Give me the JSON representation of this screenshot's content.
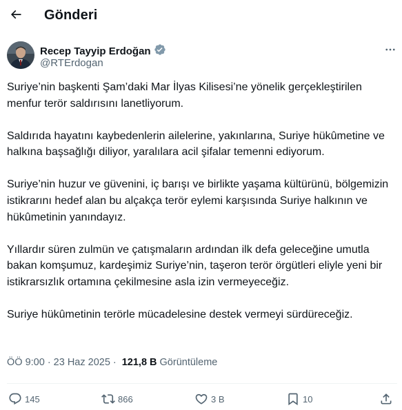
{
  "header": {
    "title": "Gönderi",
    "back_icon": "arrow-left-icon"
  },
  "author": {
    "name": "Recep Tayyip Erdoğan",
    "handle": "@RTErdogan",
    "verified_icon": "verified-badge-icon",
    "verified_color": "#829aab"
  },
  "tweet": {
    "paragraphs": [
      "Suriye’nin başkenti Şam’daki Mar İlyas Kilisesi’ne yönelik gerçekleştirilen menfur terör saldırısını lanetliyorum.",
      "Saldırıda hayatını kaybedenlerin ailelerine, yakınlarına, Suriye hükûmetine ve halkına başsağlığı diliyor, yaralılara acil şifalar temenni ediyorum.",
      "Suriye’nin huzur ve güvenini, iç barışı ve birlikte yaşama kültürünü, bölgemizin istikrarını hedef alan bu alçakça terör eylemi karşısında Suriye halkının ve hükûmetinin yanındayız.",
      "Yıllardır süren zulmün ve çatışmaların ardından ilk defa geleceğine umutla bakan komşumuz, kardeşimiz Suriye’nin, taşeron terör örgütleri eliyle yeni bir istikrarsızlık ortamına çekilmesine asla izin vermeyeceğiz.",
      "Suriye hükûmetinin terörle mücadelesine destek vermeyi sürdüreceğiz."
    ]
  },
  "meta": {
    "time": "ÖÖ 9:00",
    "separator": "·",
    "date": "23 Haz 2025",
    "views_count": "121,8 B",
    "views_label": "Görüntüleme"
  },
  "actions": {
    "replies": "145",
    "reposts": "866",
    "likes": "3 B",
    "bookmarks": "10"
  },
  "colors": {
    "text": "#0f1419",
    "secondary": "#536471",
    "divider": "#eff3f4"
  }
}
